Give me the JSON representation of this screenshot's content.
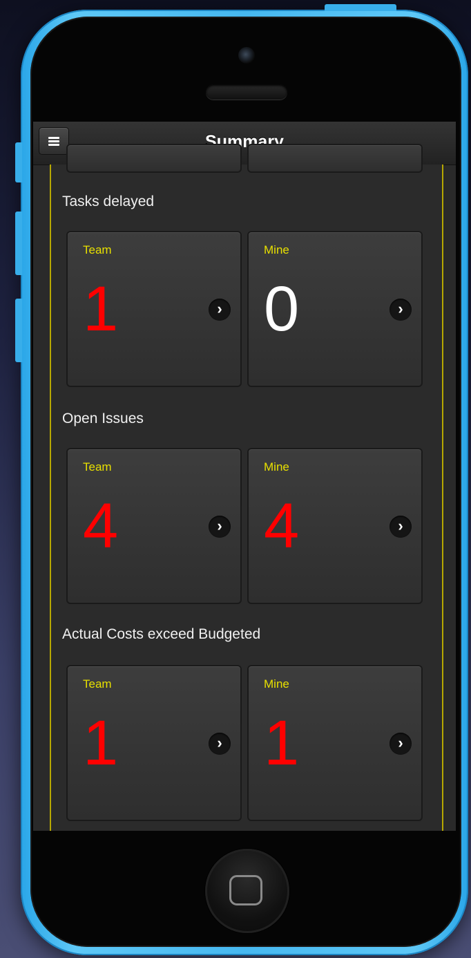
{
  "header": {
    "title": "Summary"
  },
  "sections": [
    {
      "title": "Tasks delayed",
      "tiles": [
        {
          "label": "Team",
          "value": "1",
          "value_color": "#ff0000"
        },
        {
          "label": "Mine",
          "value": "0",
          "value_color": "#ffffff"
        }
      ]
    },
    {
      "title": "Open Issues",
      "tiles": [
        {
          "label": "Team",
          "value": "4",
          "value_color": "#ff0000"
        },
        {
          "label": "Mine",
          "value": "4",
          "value_color": "#ff0000"
        }
      ]
    },
    {
      "title": "Actual Costs exceed Budgeted",
      "tiles": [
        {
          "label": "Team",
          "value": "1",
          "value_color": "#ff0000"
        },
        {
          "label": "Mine",
          "value": "1",
          "value_color": "#ff0000"
        }
      ]
    }
  ],
  "colors": {
    "accent_border": "#b7a800",
    "tile_label": "#e8e000",
    "phone_body": "#46b8f0"
  },
  "icons": {
    "menu": "menu-icon",
    "drill_down": "chevron-right-icon"
  }
}
